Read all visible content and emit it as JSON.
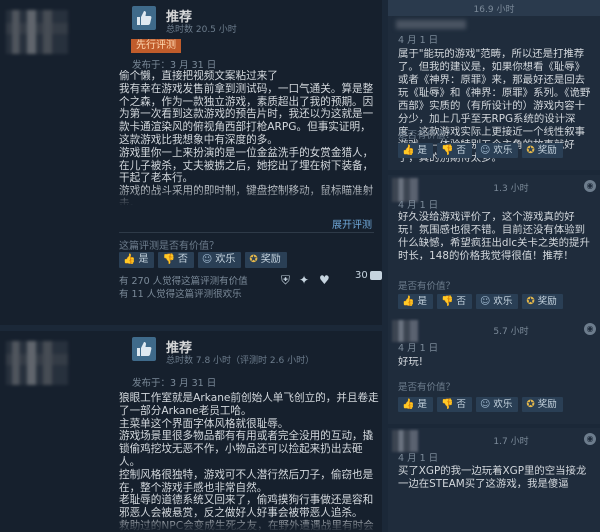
{
  "review1": {
    "rating": "推荐",
    "hours": "总时数 20.5 小时",
    "early_access_badge": "先行评测",
    "posted": "发布于：3 月 31 日",
    "body": "偷个懒，直接把视频文案粘过来了\n我有幸在游戏发售前拿到测试码，一口气通关。算是整个之森，作为一款独立游戏，素质超出了我的预期。因为第一次看到这款游戏的预告片时，我还以为这就是一款卡通渲染风的俯视角西部打枪ARPG。但事实证明，这款游戏比我想象中有深度的多。\n游戏里你一上来扮演的是一位金盆洗手的女赏金猎人，在儿子被杀，丈夫被掳之后，她挖出了埋在树下装备，干起了老本行。\n游戏的战斗采用的即时制，键盘控制移动，鼠标瞄准射击。\n你可以在举枪时按下shift踏跃到空中进入子弹时间，当你击杀区域中的最后一名敌人时，还会有个特写镜头，可以说非常的《马克思·佩恩》。不过《诡野西部》绝不只是一款带子弹时间的俯视角双摇杆射击，而且尤其在前期，你的弹药数量可是不够你一路突突突的。弹尽粮绝，被全覆地的人来的围困脑，最后不得不拿刀上挥被的的。这个",
    "expand": "展开评测",
    "helpful_question": "这篇评测是否有价值？",
    "votes": {
      "yes": "是",
      "no": "否",
      "funny": "欢乐",
      "award": "奖励"
    },
    "stats": [
      "有 270 人觉得这篇评测有价值",
      "有 11 人觉得这篇评测很欢乐"
    ],
    "comment_count": "30"
  },
  "review2": {
    "rating": "推荐",
    "hours": "总时数 7.8 小时（评测时 2.6 小时）",
    "posted": "发布于：3 月 31 日",
    "body": "狼眼工作室就是Arkane前创始人单飞创立的，并且卷走了一部分Arkane老员工哈。\n主菜单这个界面字体风格就很耻辱。\n游戏场景里很多物品都有有用或者完全没用的互动，撬锁偷鸡挖坟无恶不作，小物品还可以捡起来扔出去砸人。\n控制风格很独特，游戏可不人潜行然后刀子，偷窃也是在，整个游戏手感也非常自然。\n老耻辱的道德系统又回来了，偷鸡摸狗行事做还是容和邪恶人会被悬赏，反之做好人好事会被带恶人追杀。\n救助过的NPC会变成生死之友，在野外遭遇战里有时会出现助你一臂之力。声誉高了卖卖东西会获得贵真的折扣。\n最爱目标如果抓活的回来，过段时间会被保释出去加入敌对势力在遭遇战里追杀你，再次抓捕会获得更多的赏金，好家伙七擒孟获是吧。\n收集道具加技能，这个技能图标设置用UI也太熟悉了，每个主角有5"
  },
  "comments": [
    {
      "hours": "16.9 小时",
      "date": "4 月 1 日",
      "body": "属于\"能玩的游戏\"范畴，所以还是打推荐了。但我的建议是，如果你想看《耻辱》或者《神界：原罪》来，那最好还是回去玩《耻辱》和《神界：原罪》系列。《诡野西部》实质的（有所设计的）游戏内容十分少，加上几乎至无RPG系统的设计深度，这款游戏实际上更接近一个线性叙事游戏——体验特别五个主角的故事就好了，真的别期待太多。",
      "helpful": "是否有价值？",
      "votes": {
        "yes": "是",
        "no": "否",
        "funny": "欢乐",
        "award": "奖励"
      }
    },
    {
      "hours": "1.3 小时",
      "date": "4 月 1 日",
      "body": "好久没给游戏评价了，这个游戏真的好玩！氛围感也很不错。目前还没有体验到什么缺憾，希望疯狂出dlc关卡之类的提升时长，148的价格我觉得很值！推荐！",
      "helpful": "是否有价值？",
      "votes": {
        "yes": "是",
        "no": "否",
        "funny": "欢乐",
        "award": "奖励"
      }
    },
    {
      "hours": "5.7 小时",
      "date": "4 月 1 日",
      "body": "好玩!",
      "helpful": "是否有价值？",
      "votes": {
        "yes": "是",
        "no": "否",
        "funny": "欢乐",
        "award": "奖励"
      }
    },
    {
      "hours": "1.7 小时",
      "date": "4 月 1 日",
      "body": "买了XGP的我一边玩着XGP里的空当接龙一边在STEAM买了这游戏，我是傻逼",
      "helpful": "",
      "votes": {}
    }
  ]
}
